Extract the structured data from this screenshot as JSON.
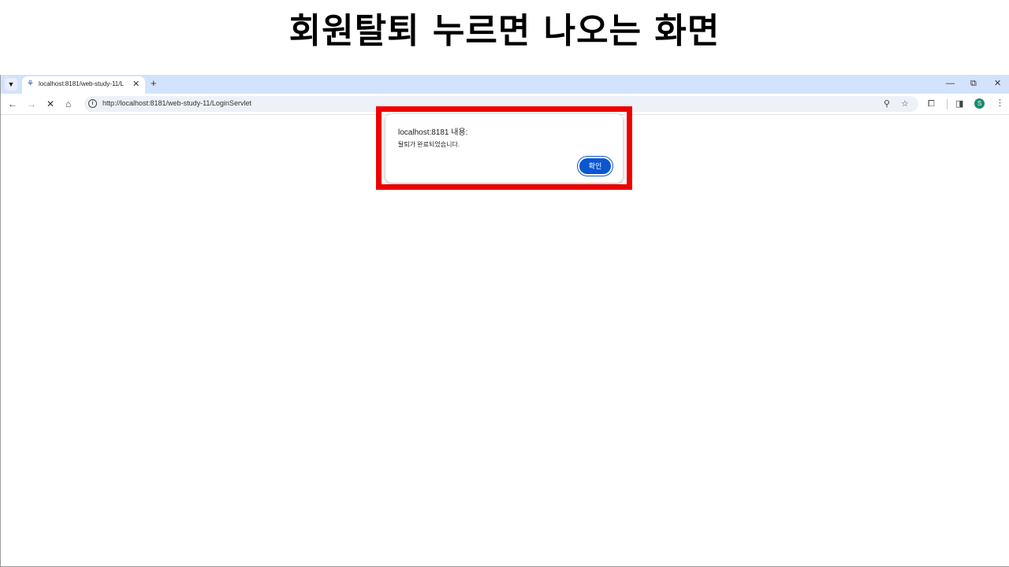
{
  "slide": {
    "title": "회원탈퇴 누르면 나오는 화면"
  },
  "browser": {
    "tab": {
      "title": "localhost:8181/web-study-11/L"
    },
    "address_bar": {
      "url": "http://localhost:8181/web-study-11/LoginServlet"
    },
    "profile_initial": "S"
  },
  "dialog": {
    "title": "localhost:8181 내용:",
    "message": "탈퇴가 완료되었습니다.",
    "ok_label": "확인"
  },
  "colors": {
    "highlight": "#ee0000",
    "accent": "#0b57d0",
    "tabstrip": "#d3e3fd"
  }
}
